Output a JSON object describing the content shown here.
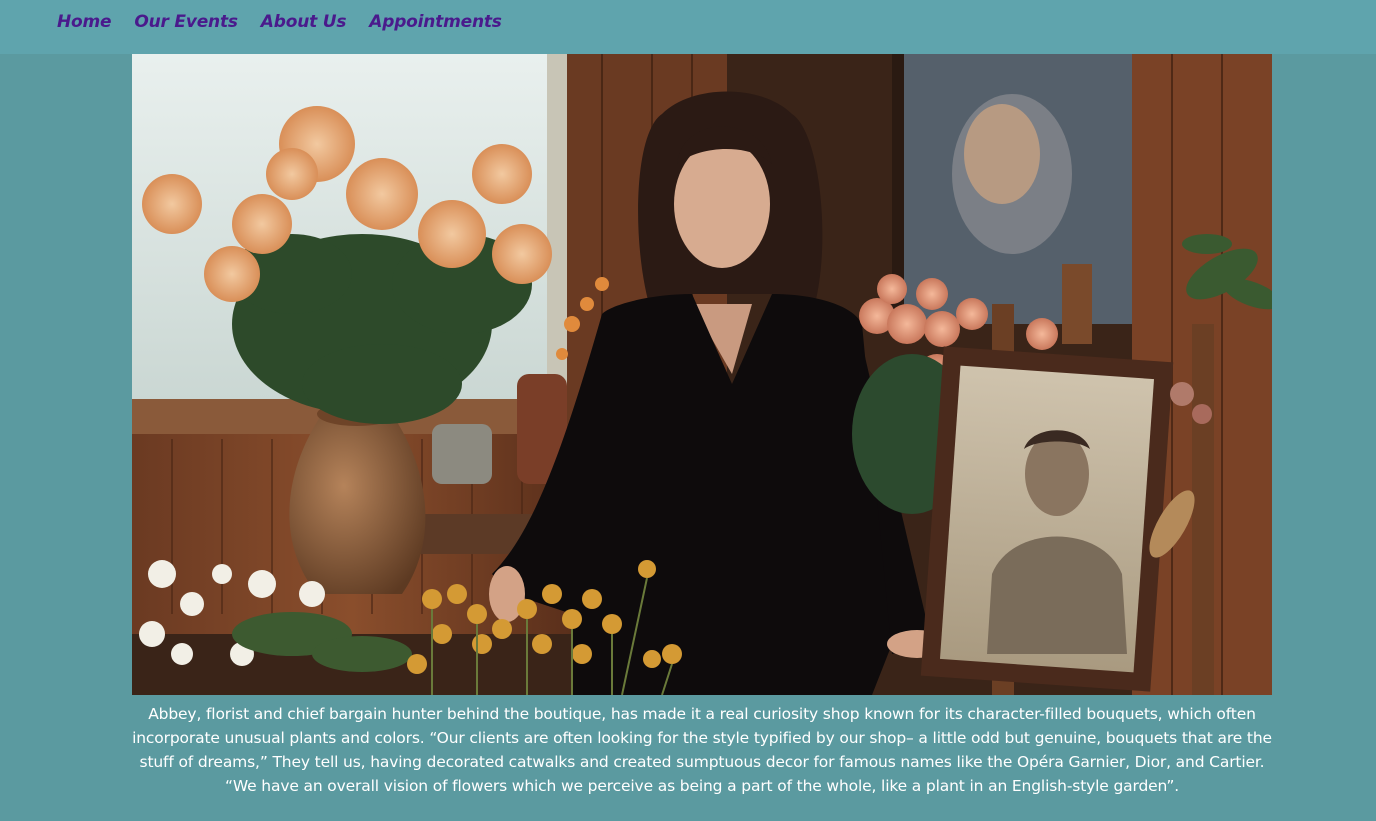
{
  "nav": {
    "items": [
      {
        "label": "Home"
      },
      {
        "label": "Our Events"
      },
      {
        "label": "About Us"
      },
      {
        "label": "Appointments"
      }
    ]
  },
  "colors": {
    "page_background": "#5b9aa0",
    "nav_background": "#5fa4ad",
    "nav_link": "#4a1a8c",
    "caption_text": "#ffffff"
  },
  "hero": {
    "subject": "photo-of-florist-with-flowers-and-portrait"
  },
  "caption": {
    "text": "Abbey, florist and chief bargain hunter behind the boutique, has made it a real curiosity shop known for its character-filled bouquets, which often incorporate unusual plants and colors. “Our clients are often looking for the style typified by our shop– a little odd but genuine, bouquets that are the stuff of dreams,” They tell us, having decorated catwalks and created sumptuous decor for famous names like the Opéra Garnier, Dior, and Cartier. “We have an overall vision of flowers which we perceive as being a part of the whole, like a plant in an English-style garden”."
  }
}
